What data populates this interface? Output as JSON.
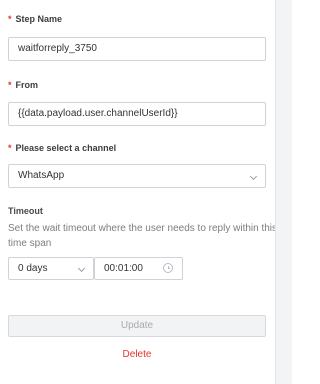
{
  "form": {
    "step_name": {
      "required_mark": "*",
      "label": "Step Name",
      "value": "waitforreply_3750"
    },
    "from": {
      "required_mark": "*",
      "label": "From",
      "value": "{{data.payload.user.channelUserId}}"
    },
    "channel": {
      "required_mark": "*",
      "label": "Please select a channel",
      "selected": "WhatsApp",
      "icon": "chevron-down-icon"
    },
    "timeout": {
      "label": "Timeout",
      "description": "Set the wait timeout where the user needs to reply within this time span",
      "days_selected": "0 days",
      "days_icon": "chevron-down-icon",
      "time_value": "00:01:00",
      "time_icon": "clock-icon"
    },
    "actions": {
      "update_label": "Update",
      "delete_label": "Delete"
    }
  },
  "colors": {
    "required": "#e5342b",
    "delete": "#e5342b",
    "border": "#cfd3d8",
    "disabled_bg": "#f2f3f4",
    "disabled_text": "#a6abb0"
  }
}
